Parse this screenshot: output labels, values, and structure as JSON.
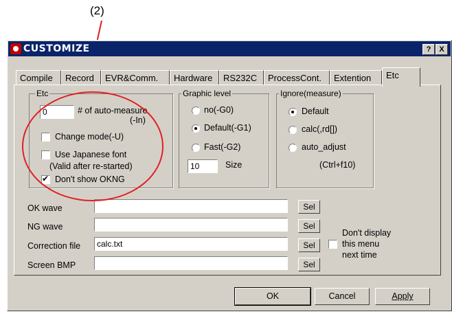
{
  "callout": "(2)",
  "window": {
    "title": "CUSTOMIZE",
    "help_btn": "?",
    "close_btn": "X"
  },
  "tabs": [
    "Compile",
    "Record",
    "EVR&Comm.",
    "Hardware",
    "RS232C",
    "ProcessCont.",
    "Extention",
    "Etc"
  ],
  "active_tab": "Etc",
  "etc_group": {
    "legend": "Etc",
    "auto_measure_value": "0",
    "auto_measure_label": "# of auto-measure",
    "auto_measure_sub": "(-In)",
    "change_mode": {
      "label": "Change mode(-U)",
      "checked": false
    },
    "japanese_font": {
      "label": "Use Japanese font",
      "note": "(Valid after re-started)",
      "checked": false
    },
    "dont_show_okng": {
      "label": "Don't show OKNG",
      "checked": true
    }
  },
  "graphic_group": {
    "legend": "Graphic level",
    "options": [
      {
        "label": "no(-G0)",
        "selected": false
      },
      {
        "label": "Default(-G1)",
        "selected": true
      },
      {
        "label": "Fast(-G2)",
        "selected": false
      }
    ],
    "size_value": "10",
    "size_label": "Size"
  },
  "ignore_group": {
    "legend": "Ignore(measure)",
    "options": [
      {
        "label": "Default",
        "selected": true
      },
      {
        "label": "calc(,rd[])",
        "selected": false
      },
      {
        "label": "auto_adjust",
        "selected": false
      }
    ],
    "hotkey": "(Ctrl+f10)"
  },
  "files": [
    {
      "label": "OK wave",
      "value": "",
      "sel": "Sel"
    },
    {
      "label": "NG wave",
      "value": "",
      "sel": "Sel"
    },
    {
      "label": "Correction file",
      "value": "calc.txt",
      "sel": "Sel"
    },
    {
      "label": "Screen BMP",
      "value": "",
      "sel": "Sel"
    }
  ],
  "dont_display": {
    "line1": "Don't display",
    "line2": "this menu",
    "line3": "next time",
    "checked": false
  },
  "buttons": {
    "ok": "OK",
    "cancel": "Cancel",
    "apply": "Apply"
  },
  "colors": {
    "annotation": "#e02020",
    "titlebar": "#0a246a",
    "face": "#d4d0c8"
  }
}
